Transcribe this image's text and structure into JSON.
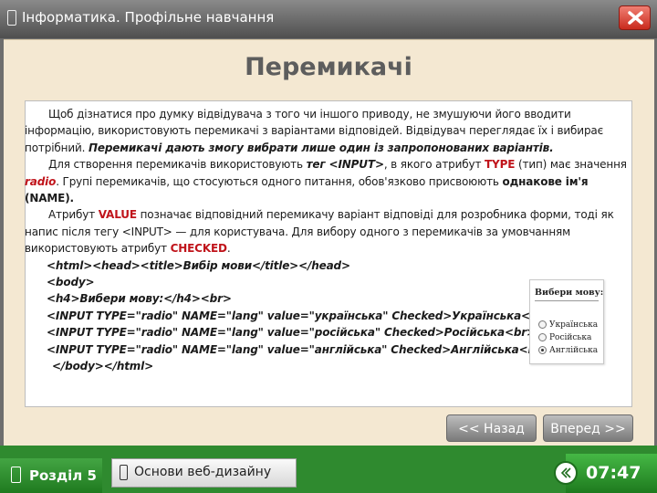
{
  "window": {
    "title": "Інформатика. Профільне навчання",
    "icon": "book-icon"
  },
  "page": {
    "heading": "Перемикачі"
  },
  "content": {
    "p1": {
      "t1": "Щоб дізнатися про думку відвідувача з того чи іншого приводу, не змушуючи його вводити інформацію, використовують перемикачі з варіантами відповідей. Відвідувач переглядає їх і вибирає потрібний. ",
      "emph": "Перемикачі дають змогу вибрати лише один із запропонованих варіантів."
    },
    "p2": {
      "t1": "Для створення перемикачів використовують ",
      "tag_label": "тег <INPUT>",
      "t2": ", в якого атрибут ",
      "type": "TYPE",
      "t3": " (тип) має значення ",
      "radio": "radio",
      "t4": ". Групі перемикачів, що стосуються одного питання, обов'язково присвоюють ",
      "name": "однакове ім'я (NAME)."
    },
    "p3": {
      "t1": "Атрибут ",
      "value": "VALUE",
      "t2": " позначає відповідний перемикачу варіант відповіді для розробника форми, тоді як напис після тегу <INPUT> — для користувача. Для вибору одного з перемикачів за умовчанням використовують атрибут ",
      "checked": "CHECKED",
      "t3": "."
    },
    "code": [
      "<html><head><title>Вибір мови</title></head>",
      "<body>",
      "<h4>Вибери мову:</h4><br>",
      "<INPUT TYPE=\"radio\" NAME=\"lang\" value=\"українська\" Checked>Українська<br>",
      "<INPUT TYPE=\"radio\" NAME=\"lang\" value=\"російська\" Checked>Російська<br>",
      "<INPUT TYPE=\"radio\" NAME=\"lang\" value=\"англійська\" Checked>Англійська<br>",
      "</body></html>"
    ]
  },
  "example": {
    "title": "Вибери мову:",
    "options": [
      "Українська",
      "Російська",
      "Англійська"
    ],
    "selected": "Англійська"
  },
  "nav": {
    "back": "<< Назад",
    "next": "Вперед >>"
  },
  "footer": {
    "section": "Розділ 5",
    "course": "Основи веб-дизайну",
    "time": "07:47"
  },
  "colors": {
    "highlight": "#c0141b",
    "panel": "#f4e8d2",
    "footer_green": "#2f8a2f"
  }
}
